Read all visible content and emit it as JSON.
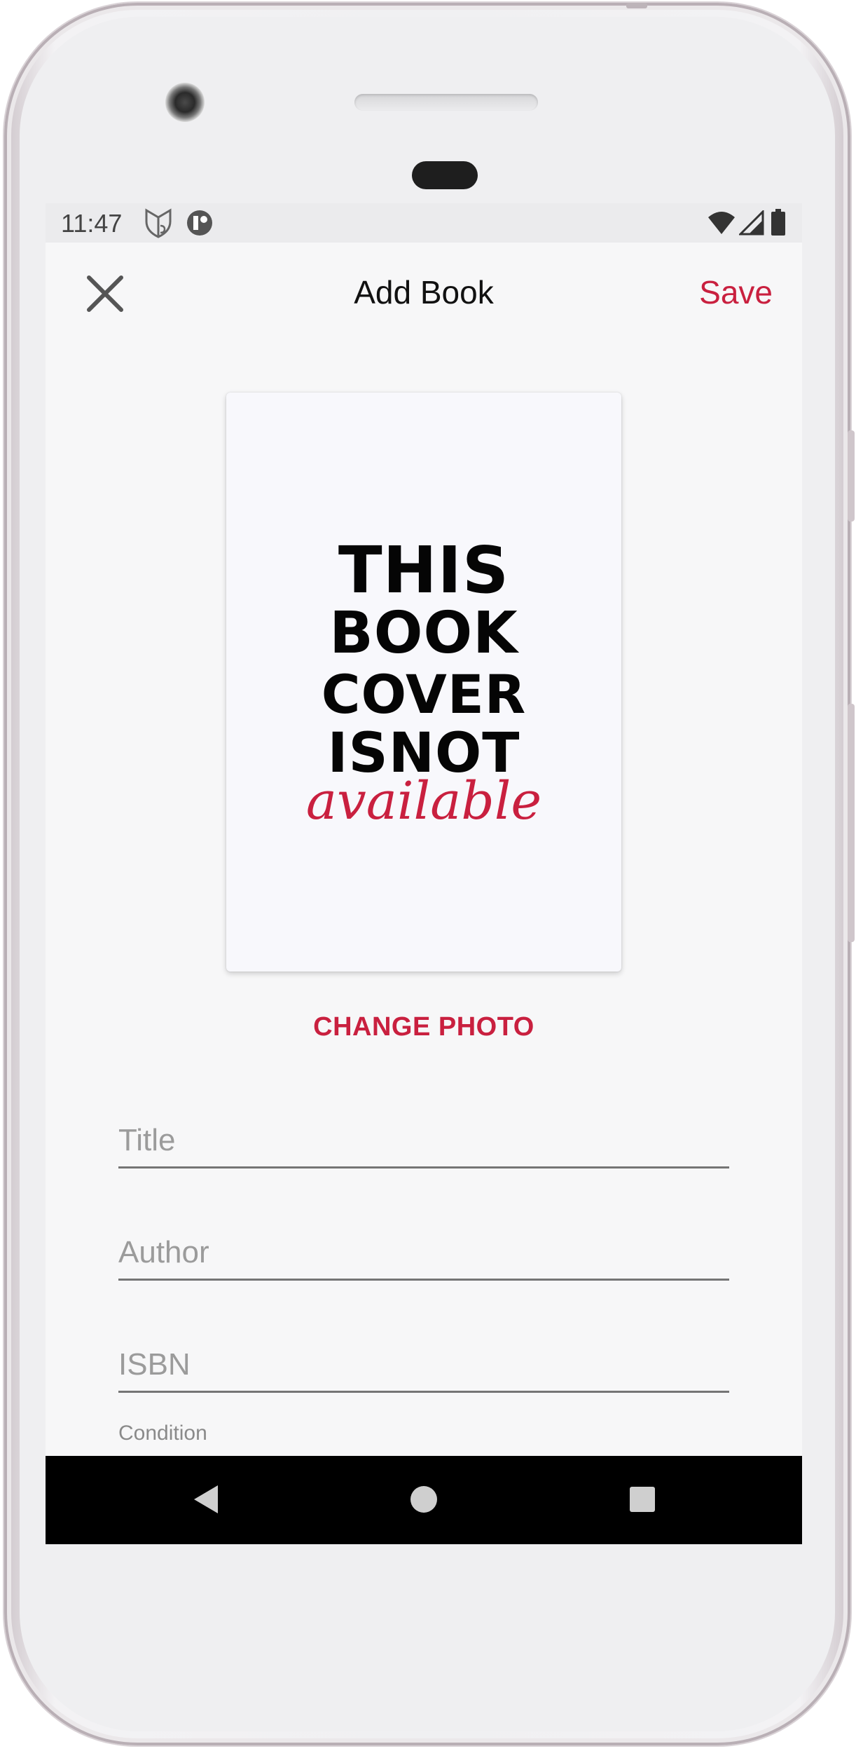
{
  "status_bar": {
    "time": "11:47"
  },
  "app_bar": {
    "title": "Add Book",
    "save_label": "Save",
    "close_icon": "close-icon"
  },
  "cover": {
    "lines": [
      "THIS",
      "BOOK",
      "COVER",
      "ISNOT"
    ],
    "available": "available"
  },
  "change_photo_label": "CHANGE PHOTO",
  "form": {
    "title_placeholder": "Title",
    "author_placeholder": "Author",
    "isbn_placeholder": "ISBN",
    "condition_label": "Condition"
  },
  "colors": {
    "accent": "#c9203f",
    "screen_bg": "#f7f7f8",
    "nav_bar": "#000000"
  },
  "nav": {
    "back_icon": "back-triangle-icon",
    "home_icon": "home-circle-icon",
    "recents_icon": "recents-square-icon"
  }
}
